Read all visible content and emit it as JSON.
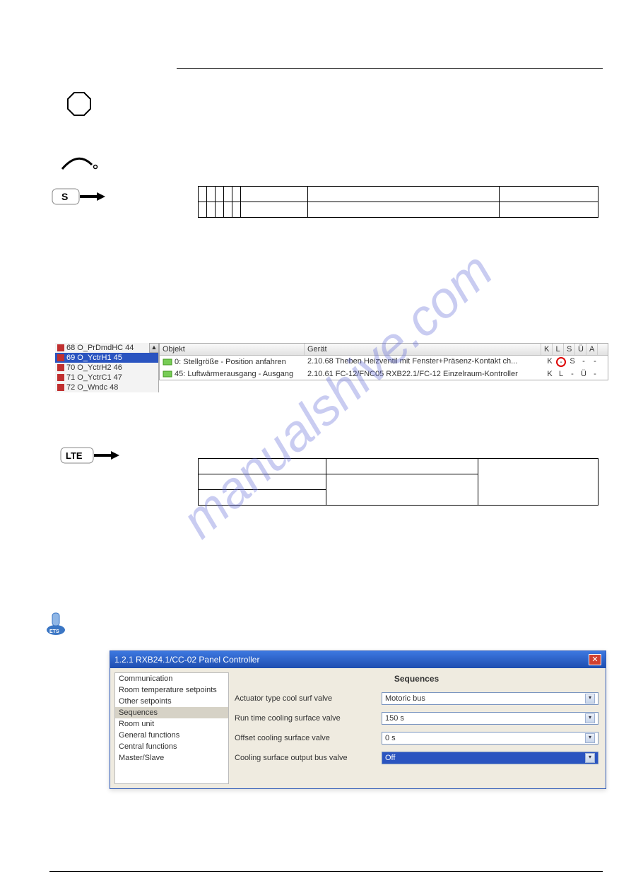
{
  "watermark_text": "manualshive.com",
  "left_icons": {
    "s_label": "S",
    "lte_label": "LTE"
  },
  "table1": {
    "cols": 6,
    "rows": 2
  },
  "tree": {
    "items": [
      {
        "label": "68 O_PrDmdHC 44",
        "selected": false
      },
      {
        "label": "69 O_YctrH1 45",
        "selected": true
      },
      {
        "label": "70 O_YctrH2 46",
        "selected": false
      },
      {
        "label": "71 O_YctrC1 47",
        "selected": false
      },
      {
        "label": "72 O_Wndc 48",
        "selected": false
      }
    ]
  },
  "list": {
    "headers": [
      "Objekt",
      "Gerät",
      "K",
      "L",
      "S",
      "Ü",
      "A"
    ],
    "rows": [
      {
        "obj": "0: Stellgröße - Position anfahren",
        "ger": "2.10.68 Theben Heizventil mit Fenster+Präsenz-Kontakt ch...",
        "k": "K",
        "l": "-",
        "s": "S",
        "u": "-",
        "a": "-",
        "circle_l": true
      },
      {
        "obj": "45: Luftwärmerausgang - Ausgang",
        "ger": "2.10.61 FC-12/FNC05 RXB22.1/FC-12 Einzelraum-Kontroller",
        "k": "K",
        "l": "L",
        "s": "-",
        "u": "Ü",
        "a": "-",
        "circle_l": false
      }
    ]
  },
  "table2": {
    "rows": [
      [
        "",
        ""
      ],
      [
        "",
        ""
      ],
      [
        "",
        ""
      ]
    ]
  },
  "dialog": {
    "title": "1.2.1 RXB24.1/CC-02 Panel Controller",
    "nav": [
      {
        "label": "Communication",
        "selected": false
      },
      {
        "label": "Room temperature setpoints",
        "selected": false
      },
      {
        "label": "Other setpoints",
        "selected": false
      },
      {
        "label": "Sequences",
        "selected": true
      },
      {
        "label": "Room unit",
        "selected": false
      },
      {
        "label": "General functions",
        "selected": false
      },
      {
        "label": "Central functions",
        "selected": false
      },
      {
        "label": "Master/Slave",
        "selected": false
      }
    ],
    "heading": "Sequences",
    "fields": [
      {
        "label": "Actuator type cool surf valve",
        "value": "Motoric bus",
        "selected": false
      },
      {
        "label": "Run time cooling surface valve",
        "value": "150 s",
        "selected": false
      },
      {
        "label": "Offset cooling surface valve",
        "value": "0 s",
        "selected": false
      },
      {
        "label": "Cooling surface output bus valve",
        "value": "Off",
        "selected": true
      }
    ]
  }
}
